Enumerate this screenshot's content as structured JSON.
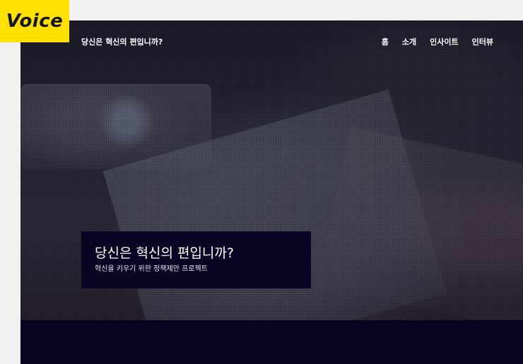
{
  "badge": {
    "label": "Voice"
  },
  "header": {
    "site_title": "당신은 혁신의 편입니까?",
    "nav": [
      "홈",
      "소개",
      "인사이트",
      "인터뷰"
    ]
  },
  "hero": {
    "title": "당신은 혁신의 편입니까?",
    "subtitle": "혁신을 키우기 위한 정책제안 프로젝트"
  },
  "colors": {
    "badge_bg": "#ffe100",
    "hero_box_bg": "#0a0425",
    "bottom_band_bg": "#090322"
  }
}
